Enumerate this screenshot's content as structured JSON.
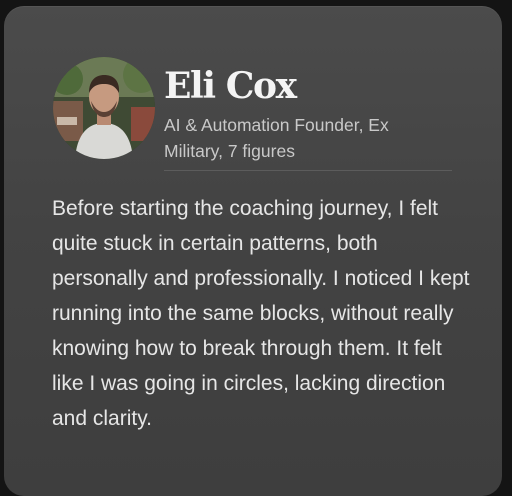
{
  "testimonial": {
    "avatar_icon": "person-photo",
    "name": "Eli Cox",
    "role": "AI & Automation Founder, Ex Military, 7 figures",
    "quote": "Before starting the coaching journey, I felt quite stuck in certain patterns, both personally and professionally. I noticed I kept running into the same blocks, without really knowing how to break through them. It felt like I was going in circles, lacking direction and clarity."
  },
  "colors": {
    "page_background": "#141414",
    "card_background": "#464646",
    "name_text": "#f4f4f4",
    "role_text": "#c9c9c9",
    "quote_text": "#e6e6e6"
  }
}
